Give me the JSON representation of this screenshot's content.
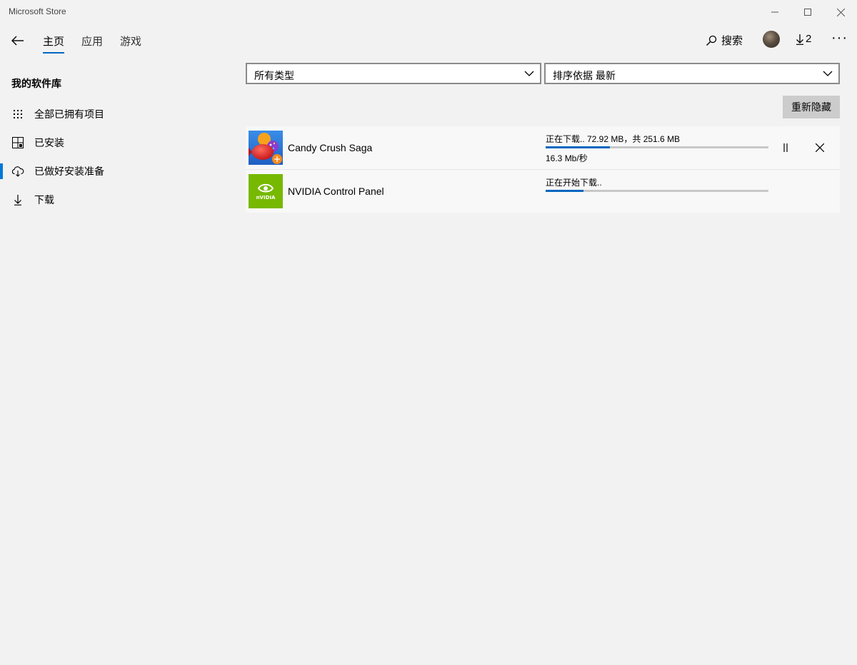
{
  "window": {
    "title": "Microsoft Store"
  },
  "nav": {
    "tabs": [
      {
        "label": "主页",
        "active": true
      },
      {
        "label": "应用",
        "active": false
      },
      {
        "label": "游戏",
        "active": false
      }
    ],
    "search_label": "搜索",
    "downloads_count": "2"
  },
  "sidebar": {
    "title": "我的软件库",
    "items": [
      {
        "label": "全部已拥有项目",
        "icon": "grid-dots-icon",
        "active": false
      },
      {
        "label": "已安装",
        "icon": "installed-grid-icon",
        "active": false
      },
      {
        "label": "已做好安装准备",
        "icon": "cloud-download-icon",
        "active": true
      },
      {
        "label": "下载",
        "icon": "download-arrow-icon",
        "active": false
      }
    ]
  },
  "filters": {
    "type_selected": "所有类型",
    "sort_selected": "排序依据 最新",
    "rehide_label": "重新隐藏"
  },
  "downloads": [
    {
      "name": "Candy Crush Saga",
      "status": "正在下载.. 72.92 MB，共 251.6 MB",
      "speed": "16.3 Mb/秒",
      "progress": 0.29
    },
    {
      "name": "NVIDIA Control Panel",
      "status": "正在开始下载..",
      "progress": 0.17
    }
  ],
  "colors": {
    "accent": "#0067c0",
    "nvidia_green": "#76b900"
  }
}
